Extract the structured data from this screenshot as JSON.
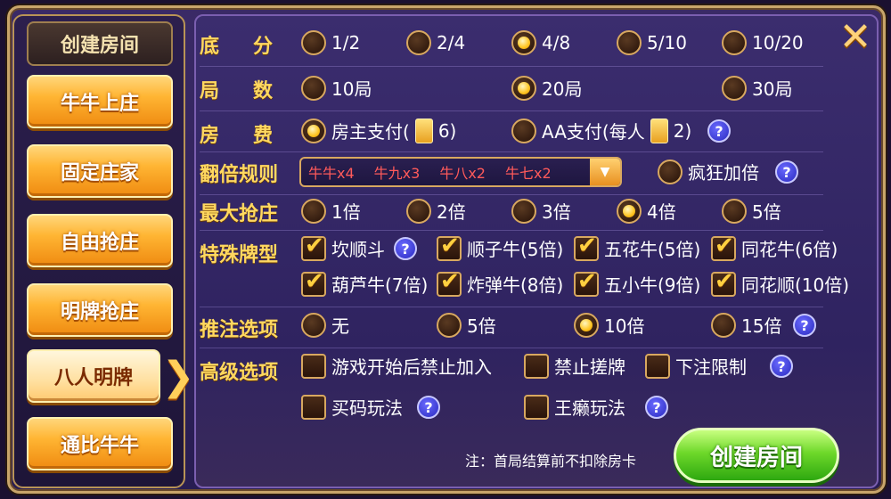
{
  "sidebar": {
    "title": "创建房间",
    "items": [
      {
        "label": "牛牛上庄",
        "active": false
      },
      {
        "label": "固定庄家",
        "active": false
      },
      {
        "label": "自由抢庄",
        "active": false
      },
      {
        "label": "明牌抢庄",
        "active": false
      },
      {
        "label": "八人明牌",
        "active": true
      },
      {
        "label": "通比牛牛",
        "active": false
      }
    ]
  },
  "rows": {
    "base_score": {
      "label": "底分",
      "options": [
        "1/2",
        "2/4",
        "4/8",
        "5/10",
        "10/20"
      ],
      "selected": "4/8"
    },
    "rounds": {
      "label": "局数",
      "options": [
        "10局",
        "20局",
        "30局"
      ],
      "selected": "20局"
    },
    "room_fee": {
      "label": "房费",
      "owner_prefix": "房主支付(",
      "owner_count": "6)",
      "aa_prefix": "AA支付(每人",
      "aa_count": "2)",
      "selected": "owner"
    },
    "multiplier_rule": {
      "label": "翻倍规则",
      "items": [
        "牛牛x4",
        "牛九x3",
        "牛八x2",
        "牛七x2"
      ],
      "crazy_label": "疯狂加倍",
      "crazy_selected": false
    },
    "max_banker": {
      "label": "最大抢庄",
      "options": [
        "1倍",
        "2倍",
        "3倍",
        "4倍",
        "5倍"
      ],
      "selected": "4倍"
    },
    "special_cards": {
      "label": "特殊牌型",
      "options": [
        {
          "label": "坎顺斗",
          "checked": true
        },
        {
          "label": "顺子牛(5倍)",
          "checked": true
        },
        {
          "label": "五花牛(5倍)",
          "checked": true
        },
        {
          "label": "同花牛(6倍)",
          "checked": true
        },
        {
          "label": "葫芦牛(7倍)",
          "checked": true
        },
        {
          "label": "炸弹牛(8倍)",
          "checked": true
        },
        {
          "label": "五小牛(9倍)",
          "checked": true
        },
        {
          "label": "同花顺(10倍)",
          "checked": true
        }
      ]
    },
    "bet_push": {
      "label": "推注选项",
      "options": [
        "无",
        "5倍",
        "10倍",
        "15倍"
      ],
      "selected": "10倍"
    },
    "advanced": {
      "label": "高级选项",
      "options": [
        {
          "label": "游戏开始后禁止加入",
          "checked": false
        },
        {
          "label": "禁止搓牌",
          "checked": false
        },
        {
          "label": "下注限制",
          "checked": false
        },
        {
          "label": "买码玩法",
          "checked": false
        },
        {
          "label": "王癞玩法",
          "checked": false
        }
      ]
    }
  },
  "footer": {
    "note": "注：首局结算前不扣除房卡",
    "create_button": "创建房间"
  },
  "icons": {
    "help": "?",
    "close": "✕",
    "dropdown": "▼",
    "arrow": "❯"
  }
}
